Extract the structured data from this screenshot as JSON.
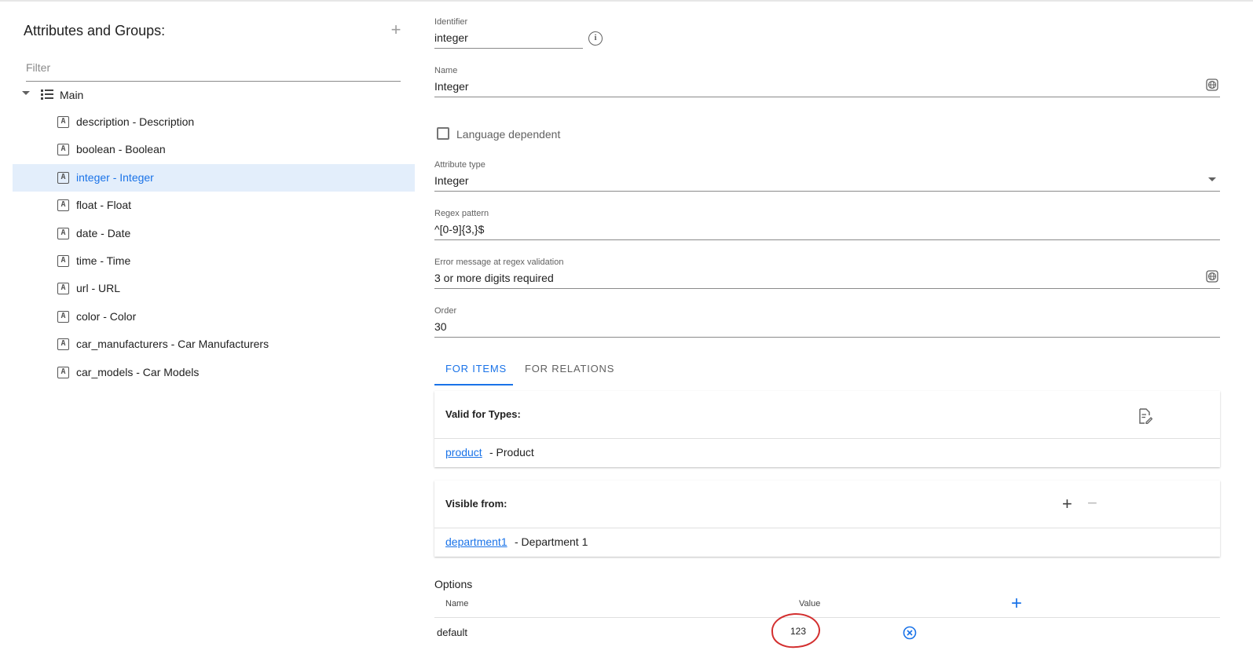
{
  "left": {
    "title": "Attributes and Groups:",
    "add_icon": "plus-icon",
    "filter_placeholder": "Filter",
    "root": {
      "label": "Main",
      "icon": "list-icon",
      "expanded": true
    },
    "items": [
      {
        "label": "description - Description",
        "selected": false
      },
      {
        "label": "boolean - Boolean",
        "selected": false
      },
      {
        "label": "integer - Integer",
        "selected": true
      },
      {
        "label": "float - Float",
        "selected": false
      },
      {
        "label": "date - Date",
        "selected": false
      },
      {
        "label": "time - Time",
        "selected": false
      },
      {
        "label": "url - URL",
        "selected": false
      },
      {
        "label": "color - Color",
        "selected": false
      },
      {
        "label": "car_manufacturers - Car Manufacturers",
        "selected": false
      },
      {
        "label": "car_models - Car Models",
        "selected": false
      }
    ],
    "item_icon_glyph": "A"
  },
  "form": {
    "identifier": {
      "label": "Identifier",
      "value": "integer"
    },
    "name": {
      "label": "Name",
      "value": "Integer"
    },
    "language_dependent": {
      "label": "Language dependent",
      "checked": false
    },
    "attribute_type": {
      "label": "Attribute type",
      "value": "Integer"
    },
    "regex": {
      "label": "Regex pattern",
      "value": "^[0-9]{3,}$"
    },
    "error_message": {
      "label": "Error message at regex validation",
      "value": "3 or more digits required"
    },
    "order": {
      "label": "Order",
      "value": "30"
    }
  },
  "tabs": [
    {
      "label": "FOR ITEMS",
      "active": true
    },
    {
      "label": "FOR RELATIONS",
      "active": false
    }
  ],
  "valid_for_types": {
    "title": "Valid for Types:",
    "link": "product",
    "desc": "- Product"
  },
  "visible_from": {
    "title": "Visible from:",
    "link": "department1",
    "desc": "- Department 1"
  },
  "options": {
    "title": "Options",
    "col_name": "Name",
    "col_value": "Value",
    "rows": [
      {
        "name": "default",
        "value": "123"
      }
    ]
  },
  "colors": {
    "accent": "#1a73e8",
    "selected_bg": "#e3eefb",
    "annotation": "#d32f2f"
  }
}
